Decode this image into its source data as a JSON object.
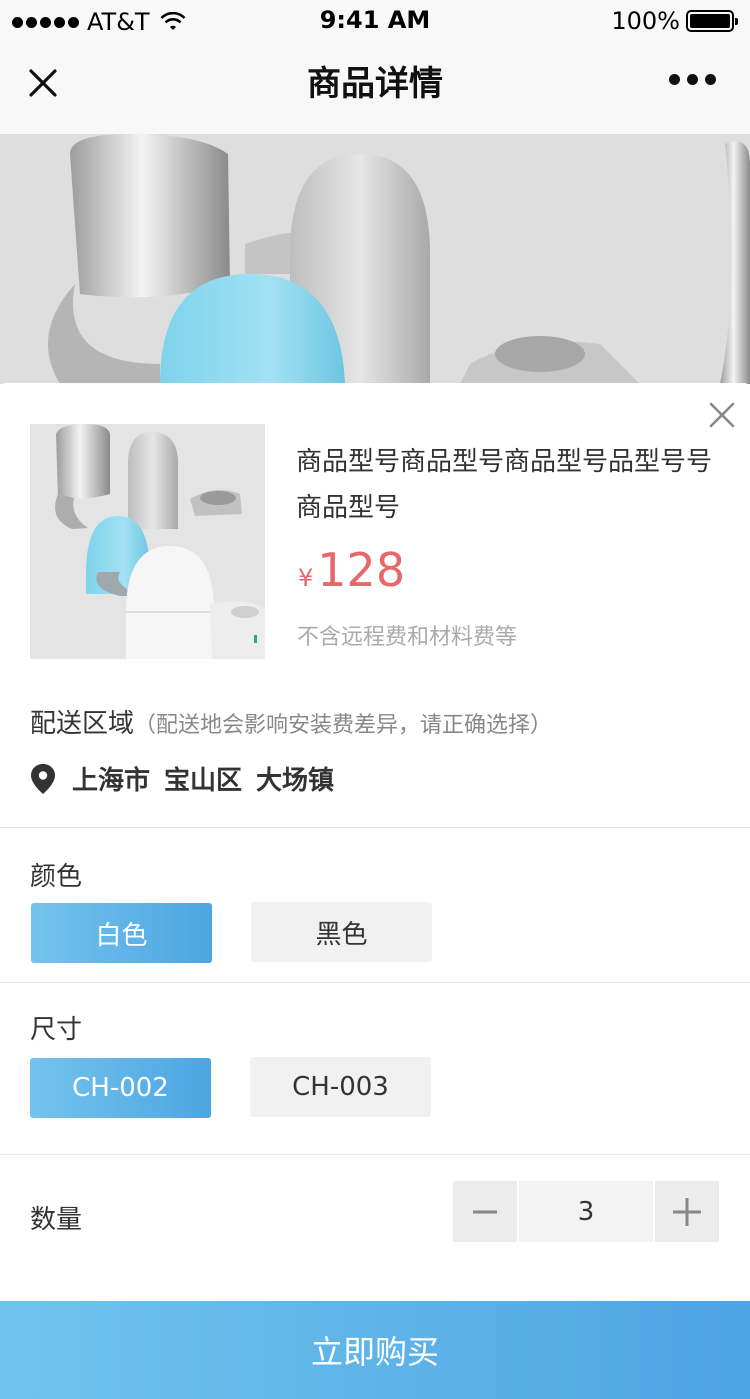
{
  "status_bar": {
    "carrier": "AT&T",
    "time": "9:41 AM",
    "battery": "100%"
  },
  "nav": {
    "title": "商品详情"
  },
  "product": {
    "name": "商品型号商品型号商品型号品型号号商品型号",
    "currency": "¥",
    "price": "128",
    "price_note": "不含远程费和材料费等"
  },
  "area": {
    "label": "配送区域",
    "hint": "（配送地会影响安装费差异，请正确选择）",
    "city": "上海市",
    "district": "宝山区",
    "town": "大场镇"
  },
  "color": {
    "label": "颜色",
    "options": [
      "白色",
      "黑色"
    ],
    "selected": "白色"
  },
  "size": {
    "label": "尺寸",
    "options": [
      "CH-002",
      "CH-003"
    ],
    "selected": "CH-002"
  },
  "quantity": {
    "label": "数量",
    "value": "3"
  },
  "buy_button": {
    "label": "立即购买"
  },
  "colors": {
    "accent_start": "#73c3ed",
    "accent_end": "#4da5e2",
    "price": "#e8676b"
  }
}
